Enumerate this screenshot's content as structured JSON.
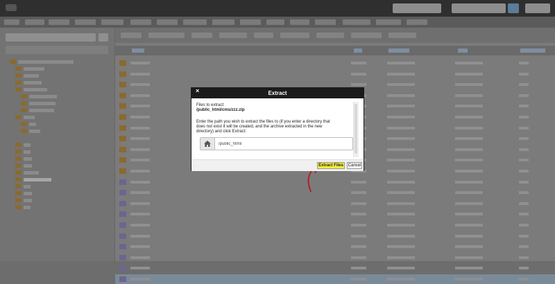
{
  "dialog": {
    "title": "Extract",
    "close_glyph": "×",
    "files_label": "Files to extract:",
    "file_path": "/public_html/cms/zzz.zip",
    "instructions_line1": "Enter the path you wish to extract the files to (if you enter a directory that",
    "instructions_line2": "does not exist it will be created, and the archive extracted in the new",
    "instructions_line3": "directory) and click Extract:",
    "path_value": "/public_html/",
    "extract_button": "Extract Files",
    "cancel_button": "Cancel",
    "home_icon": "home-icon"
  },
  "colors": {
    "dialog_header": "#1b1b1b",
    "extract_button_bg": "#f3ec3c",
    "annotation_arrow": "#b01f2a",
    "overlay": "#6d6d6d",
    "folder": "#8a6a30"
  }
}
